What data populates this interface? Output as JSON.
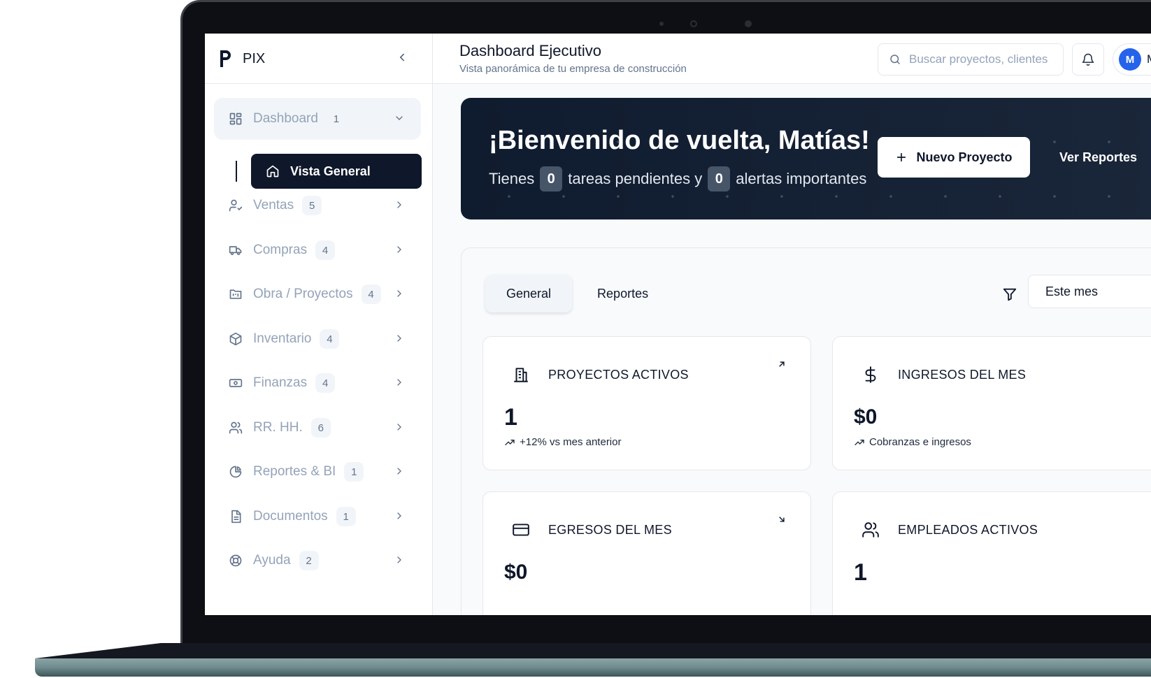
{
  "sidebar": {
    "brand": "PIX",
    "items": [
      {
        "label": "Dashboard",
        "badge": "1",
        "icon": "layout-dashboard-icon"
      },
      {
        "label": "Ventas",
        "badge": "5",
        "icon": "user-check-icon"
      },
      {
        "label": "Compras",
        "badge": "4",
        "icon": "truck-icon"
      },
      {
        "label": "Obra / Proyectos",
        "badge": "4",
        "icon": "folder-kanban-icon"
      },
      {
        "label": "Inventario",
        "badge": "4",
        "icon": "package-icon"
      },
      {
        "label": "Finanzas",
        "badge": "4",
        "icon": "banknote-icon"
      },
      {
        "label": "RR. HH.",
        "badge": "6",
        "icon": "users-icon"
      },
      {
        "label": "Reportes & BI",
        "badge": "1",
        "icon": "pie-chart-icon"
      },
      {
        "label": "Documentos",
        "badge": "1",
        "icon": "file-text-icon"
      },
      {
        "label": "Ayuda",
        "badge": "2",
        "icon": "life-buoy-icon"
      }
    ],
    "sub_item": {
      "label": "Vista General",
      "icon": "home-icon"
    }
  },
  "header": {
    "title": "Dashboard Ejecutivo",
    "subtitle": "Vista panorámica de tu empresa de construcción",
    "search_placeholder": "Buscar proyectos, clientes",
    "avatar_initial": "M",
    "user_name_visible": "M"
  },
  "hero": {
    "title": "¡Bienvenido de vuelta, Matías!",
    "line_prefix": "Tienes",
    "pending_count": "0",
    "line_middle": "tareas pendientes y",
    "alerts_count": "0",
    "line_suffix": "alertas importantes",
    "new_project_label": "Nuevo Proyecto",
    "reports_label": "Ver Reportes"
  },
  "panel": {
    "tabs": [
      {
        "label": "General",
        "active": true
      },
      {
        "label": "Reportes",
        "active": false
      }
    ],
    "period": "Este mes",
    "cards": [
      {
        "title": "PROYECTOS ACTIVOS",
        "value": "1",
        "sub": "+12% vs mes anterior",
        "icon": "building-icon",
        "trend": "arrow-up-right-icon"
      },
      {
        "title": "INGRESOS DEL MES",
        "value": "$0",
        "sub": "Cobranzas e ingresos",
        "icon": "dollar-sign-icon",
        "trend": ""
      },
      {
        "title": "EGRESOS DEL MES",
        "value": "$0",
        "sub": "",
        "icon": "credit-card-icon",
        "trend": "arrow-down-right-icon"
      },
      {
        "title": "EMPLEADOS ACTIVOS",
        "value": "1",
        "sub": "",
        "icon": "users-icon",
        "trend": ""
      }
    ]
  },
  "colors": {
    "primary": "#0f172a",
    "avatar": "#2563eb",
    "muted": "#94a3b8"
  }
}
